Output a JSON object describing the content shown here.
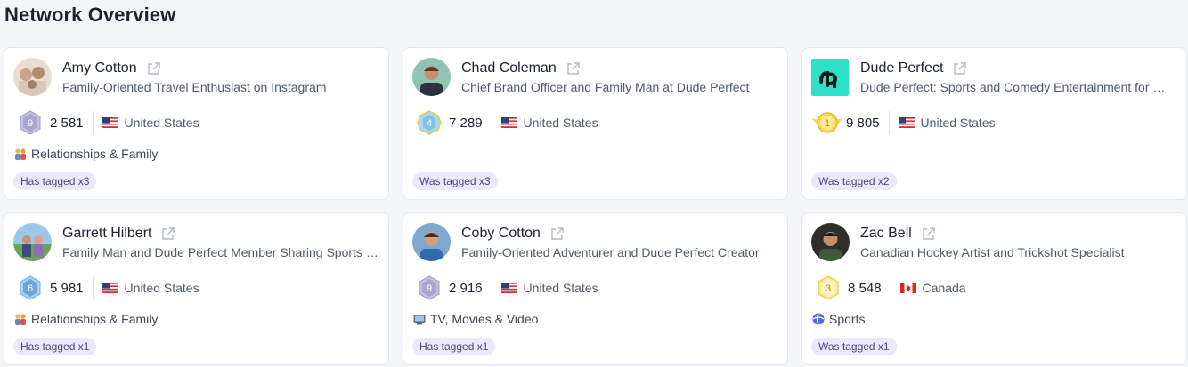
{
  "page": {
    "title": "Network Overview"
  },
  "cards": [
    {
      "name": "Amy Cotton",
      "description": "Family-Oriented Travel Enthusiast on Instagram",
      "badge_level": "9",
      "followers": "2 581",
      "country": "United States",
      "category": "Relationships & Family",
      "tag": "Has tagged x3"
    },
    {
      "name": "Chad Coleman",
      "description": "Chief Brand Officer and Family Man at Dude Perfect",
      "badge_level": "4",
      "followers": "7 289",
      "country": "United States",
      "category": "",
      "tag": "Was tagged x3"
    },
    {
      "name": "Dude Perfect",
      "description": "Dude Perfect: Sports and Comedy Entertainment for Millions",
      "badge_level": "1",
      "followers": "9 805",
      "country": "United States",
      "category": "",
      "tag": "Was tagged x2"
    },
    {
      "name": "Garrett Hilbert",
      "description": "Family Man and Dude Perfect Member Sharing Sports Moments",
      "badge_level": "6",
      "followers": "5 981",
      "country": "United States",
      "category": "Relationships & Family",
      "tag": "Has tagged x1"
    },
    {
      "name": "Coby Cotton",
      "description": "Family-Oriented Adventurer and Dude Perfect Creator",
      "badge_level": "9",
      "followers": "2 916",
      "country": "United States",
      "category": "TV, Movies & Video",
      "tag": "Has tagged x1"
    },
    {
      "name": "Zac Bell",
      "description": "Canadian Hockey Artist and Trickshot Specialist",
      "badge_level": "3",
      "followers": "8 548",
      "country": "Canada",
      "category": "Sports",
      "tag": "Was tagged x1"
    }
  ],
  "colors": {
    "tag_bg": "#ece8fb",
    "badge_silver": "#b9bdd9",
    "badge_gold": "#f5cf4a"
  }
}
